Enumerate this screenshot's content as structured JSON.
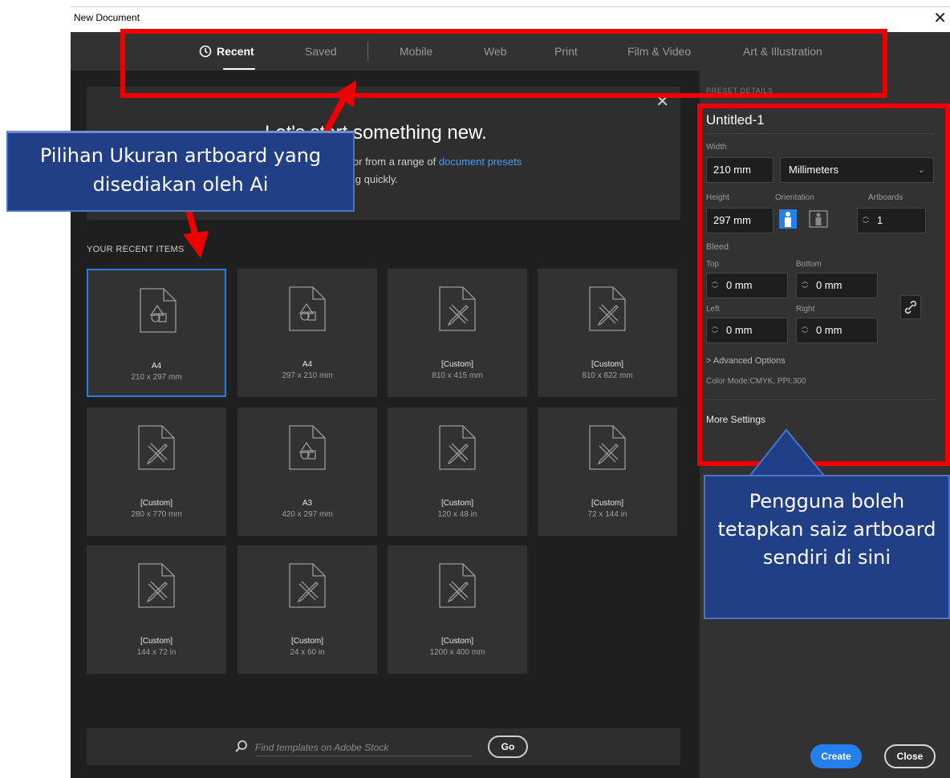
{
  "window": {
    "title": "New Document",
    "close_glyph": "✕"
  },
  "tabs": [
    {
      "label": "Recent",
      "active": true
    },
    {
      "label": "Saved",
      "active": false
    },
    {
      "label": "Mobile",
      "active": false
    },
    {
      "label": "Web",
      "active": false
    },
    {
      "label": "Print",
      "active": false
    },
    {
      "label": "Film & Video",
      "active": false
    },
    {
      "label": "Art & Illustration",
      "active": false
    }
  ],
  "banner": {
    "heading": "Let's start something new.",
    "line1_prefix": "ettings or from a range of",
    "line1_link": "document presets",
    "line2": ": working quickly.",
    "close_glyph": "✕"
  },
  "recent": {
    "heading": "YOUR RECENT ITEMS",
    "items": [
      {
        "name": "A4",
        "size": "210 x 297 mm",
        "icon": "shapes-icon",
        "selected": true
      },
      {
        "name": "A4",
        "size": "297 x 210 mm",
        "icon": "shapes-icon",
        "selected": false
      },
      {
        "name": "[Custom]",
        "size": "810 x 415 mm",
        "icon": "pencil-ruler-icon",
        "selected": false
      },
      {
        "name": "[Custom]",
        "size": "810 x 822 mm",
        "icon": "pencil-ruler-icon",
        "selected": false
      },
      {
        "name": "[Custom]",
        "size": "280 x 770 mm",
        "icon": "pencil-ruler-icon",
        "selected": false
      },
      {
        "name": "A3",
        "size": "420 x 297 mm",
        "icon": "shapes-icon",
        "selected": false
      },
      {
        "name": "[Custom]",
        "size": "120 x 48 in",
        "icon": "pencil-ruler-icon",
        "selected": false
      },
      {
        "name": "[Custom]",
        "size": "72 x 144 in",
        "icon": "pencil-ruler-icon",
        "selected": false
      },
      {
        "name": "[Custom]",
        "size": "144 x 72 in",
        "icon": "pencil-ruler-icon",
        "selected": false
      },
      {
        "name": "[Custom]",
        "size": "24 x 60 in",
        "icon": "pencil-ruler-icon",
        "selected": false
      },
      {
        "name": "[Custom]",
        "size": "1200 x 400 mm",
        "icon": "pencil-ruler-icon",
        "selected": false
      }
    ]
  },
  "search": {
    "placeholder": "Find templates on Adobe Stock",
    "go_label": "Go"
  },
  "preset": {
    "label": "PRESET DETAILS",
    "name": "Untitled-1",
    "width_label": "Width",
    "width_value": "210 mm",
    "units": "Millimeters",
    "height_label": "Height",
    "height_value": "297 mm",
    "orientation_label": "Orientation",
    "artboards_label": "Artboards",
    "artboards_value": "1",
    "bleed_label": "Bleed",
    "bleed_top_label": "Top",
    "bleed_top": "0 mm",
    "bleed_bottom_label": "Bottom",
    "bleed_bottom": "0 mm",
    "bleed_left_label": "Left",
    "bleed_left": "0 mm",
    "bleed_right_label": "Right",
    "bleed_right": "0 mm",
    "advanced": "> Advanced Options",
    "color_mode": "Color Mode:CMYK, PPI:300",
    "more_settings": "More Settings"
  },
  "actions": {
    "create": "Create",
    "close": "Close"
  },
  "annotations": {
    "left_callout": "Pilihan Ukuran artboard yang disediakan oleh Ai",
    "right_callout": "Pengguna boleh tetapkan saiz artboard sendiri di sini"
  },
  "colors": {
    "accent": "#2680eb",
    "annotation_red": "#ee0000",
    "callout_blue": "#203f86"
  }
}
